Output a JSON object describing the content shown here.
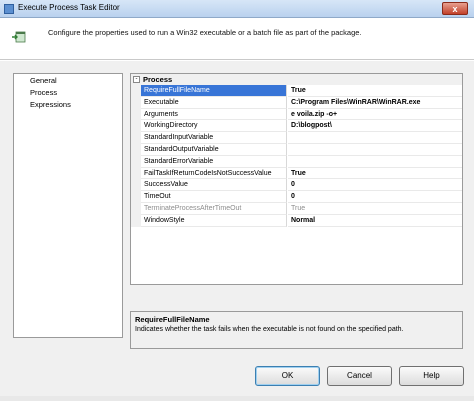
{
  "window": {
    "title": "Execute Process Task Editor",
    "close_glyph": "x"
  },
  "header": {
    "description": "Configure the properties used to run a Win32 executable or a batch file as part of the package.",
    "icon": "execute-process-task-icon"
  },
  "nav": {
    "items": [
      {
        "label": "General"
      },
      {
        "label": "Process"
      },
      {
        "label": "Expressions"
      }
    ]
  },
  "grid": {
    "category": {
      "label": "Process",
      "toggle_glyph": "-"
    },
    "rows": [
      {
        "name": "RequireFullFileName",
        "value": "True",
        "state": "selected"
      },
      {
        "name": "Executable",
        "value": "C:\\Program Files\\WinRAR\\WinRAR.exe",
        "state": "normal"
      },
      {
        "name": "Arguments",
        "value": "e voila.zip -o+",
        "state": "normal"
      },
      {
        "name": "WorkingDirectory",
        "value": "D:\\blogpost\\",
        "state": "normal"
      },
      {
        "name": "StandardInputVariable",
        "value": "",
        "state": "normal"
      },
      {
        "name": "StandardOutputVariable",
        "value": "",
        "state": "normal"
      },
      {
        "name": "StandardErrorVariable",
        "value": "",
        "state": "normal"
      },
      {
        "name": "FailTaskIfReturnCodeIsNotSuccessValue",
        "value": "True",
        "state": "normal"
      },
      {
        "name": "SuccessValue",
        "value": "0",
        "state": "normal"
      },
      {
        "name": "TimeOut",
        "value": "0",
        "state": "normal"
      },
      {
        "name": "TerminateProcessAfterTimeOut",
        "value": "True",
        "state": "disabled"
      },
      {
        "name": "WindowStyle",
        "value": "Normal",
        "state": "normal"
      }
    ]
  },
  "description_panel": {
    "title": "RequireFullFileName",
    "text": "Indicates whether the task fails when the executable is not found on the specified path."
  },
  "buttons": {
    "ok": "OK",
    "cancel": "Cancel",
    "help": "Help"
  },
  "colors": {
    "selection": "#3875d7",
    "disabled_text": "#8d8d8d"
  }
}
